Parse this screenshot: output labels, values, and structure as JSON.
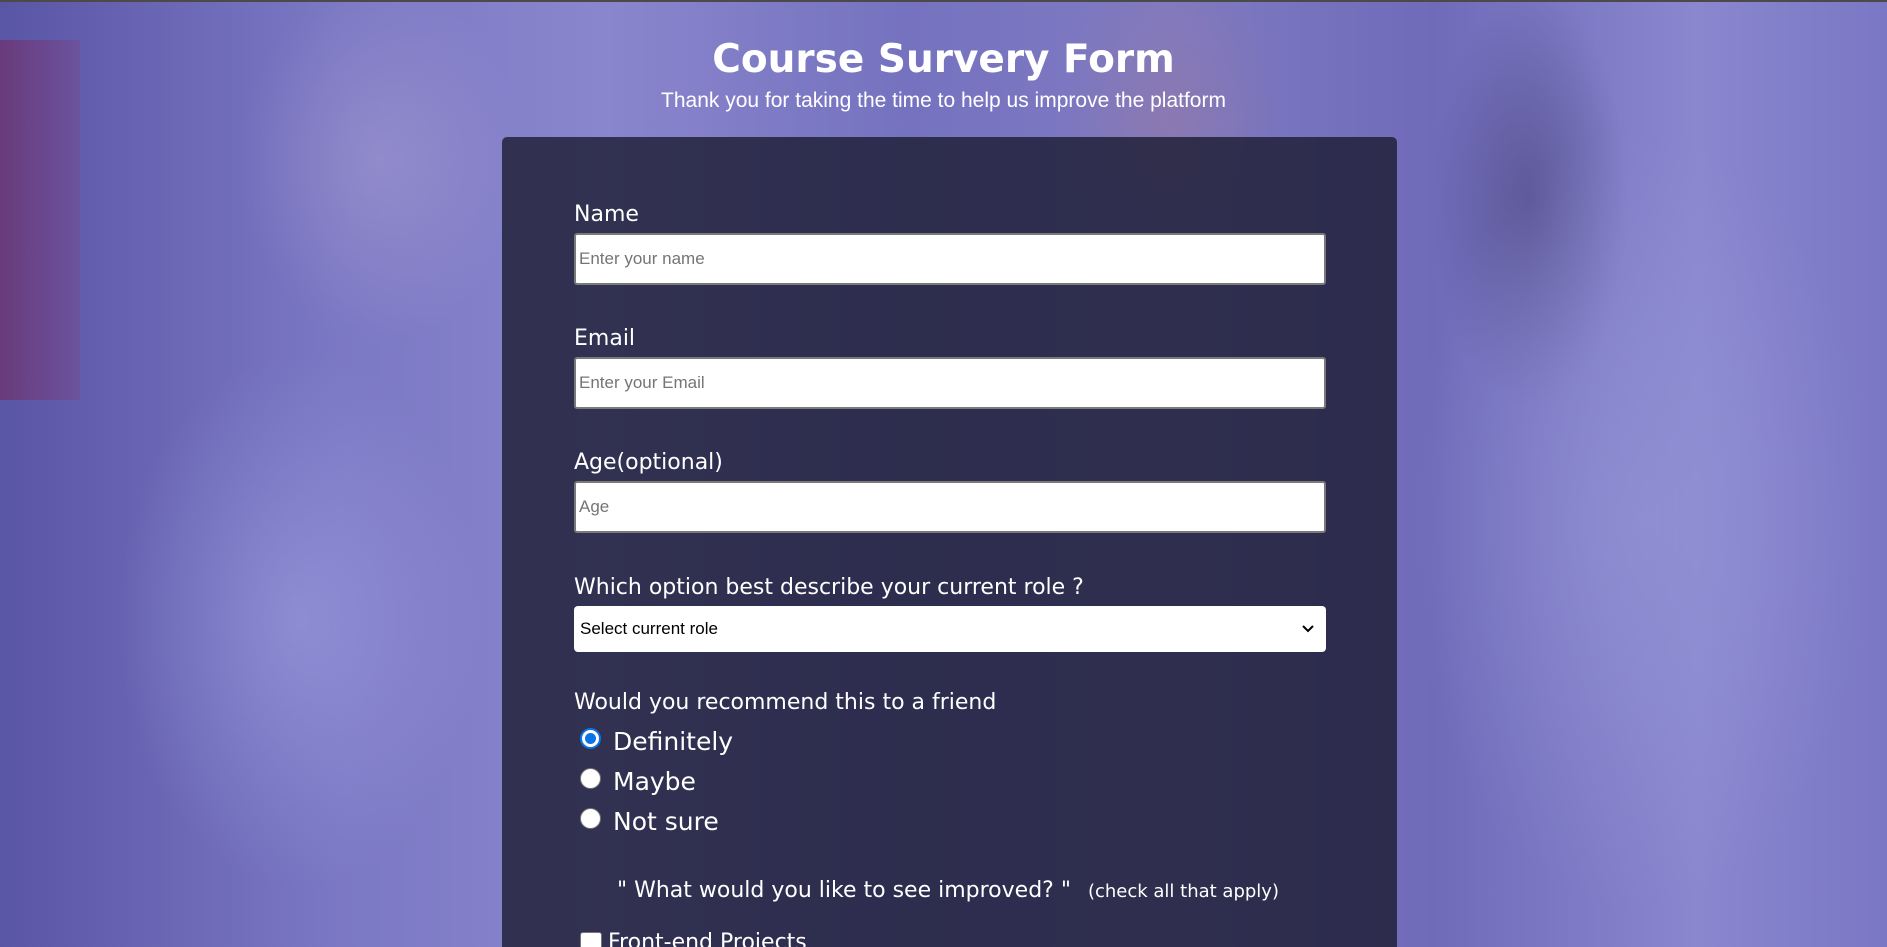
{
  "header": {
    "title": "Course Survery Form",
    "subtitle": "Thank you for taking the time to help us improve the platform"
  },
  "form": {
    "name": {
      "label": "Name",
      "placeholder": "Enter your name"
    },
    "email": {
      "label": "Email",
      "placeholder": "Enter your Email"
    },
    "age": {
      "label": "Age(optional)",
      "placeholder": "Age"
    },
    "role": {
      "label": "Which option best describe your current role ?",
      "selected": "Select current role"
    },
    "recommend": {
      "label": "Would you recommend this to a friend",
      "options": [
        "Definitely",
        "Maybe",
        "Not sure"
      ],
      "selected": "Definitely"
    },
    "improve": {
      "question": "\" What would you like to see improved? \"",
      "hint": "(check all that apply)",
      "options": [
        "Front-end Projects"
      ]
    }
  },
  "icons": {
    "select": "chevron-down-icon"
  },
  "colors": {
    "accent": "#0b74e5",
    "card": "#1b1b32"
  }
}
